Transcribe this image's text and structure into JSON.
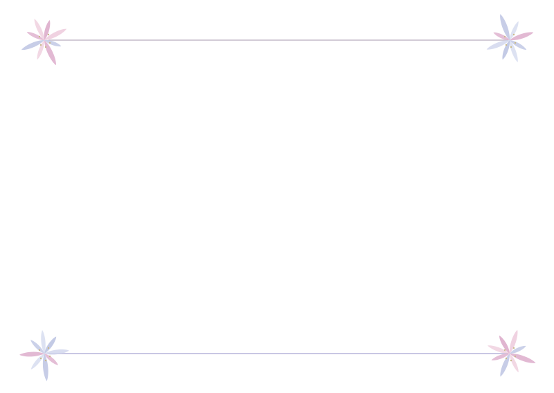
{
  "colors": {
    "pink": "#dba8c8",
    "pink_light": "#ecc7d9",
    "blue": "#b9c1e1",
    "blue_light": "#cfd5ec",
    "line_top": "#d2cbd6",
    "line_bottom": "#c9c7e3",
    "stamen": "#c9b98a"
  },
  "decorations": {
    "top_left": {
      "icon": "pink-flower-icon",
      "palette": "pink"
    },
    "top_right": {
      "icon": "blue-flower-icon",
      "palette": "blue"
    },
    "bottom_left": {
      "icon": "blue-flower-icon",
      "palette": "blue"
    },
    "bottom_right": {
      "icon": "pink-flower-icon",
      "palette": "pink"
    }
  }
}
